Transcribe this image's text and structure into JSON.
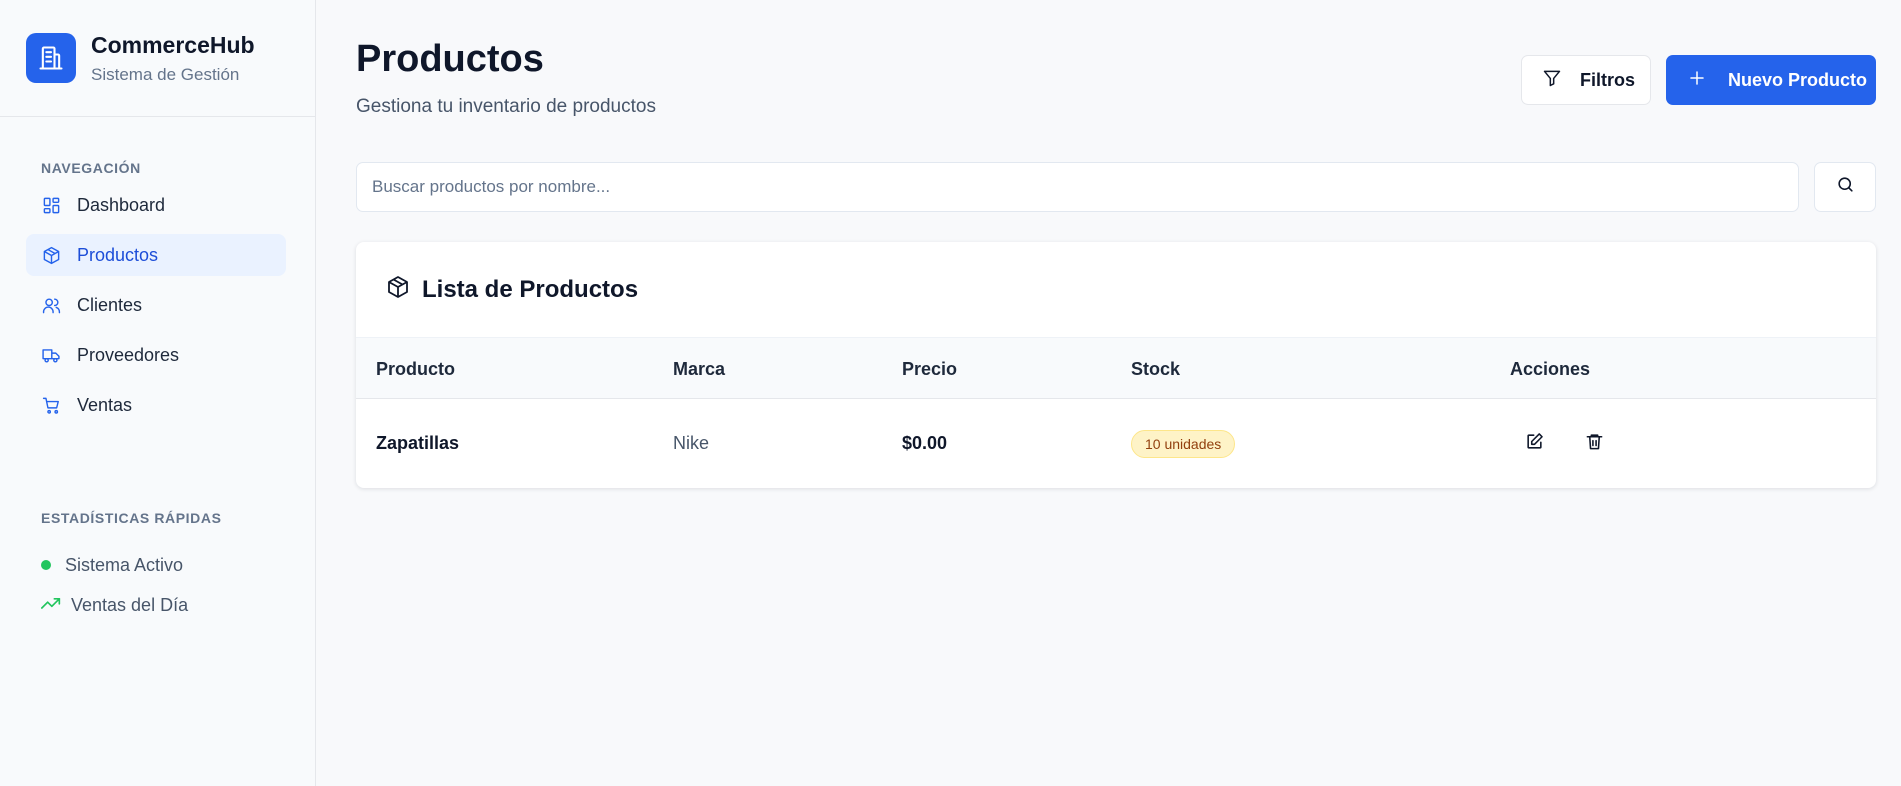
{
  "brand": {
    "name": "CommerceHub",
    "subtitle": "Sistema de Gestión"
  },
  "sidebar": {
    "nav_label": "NAVEGACIÓN",
    "items": [
      {
        "label": "Dashboard",
        "icon": "layout-grid-icon",
        "active": false
      },
      {
        "label": "Productos",
        "icon": "package-icon",
        "active": true
      },
      {
        "label": "Clientes",
        "icon": "users-icon",
        "active": false
      },
      {
        "label": "Proveedores",
        "icon": "truck-icon",
        "active": false
      },
      {
        "label": "Ventas",
        "icon": "shopping-cart-icon",
        "active": false
      }
    ],
    "stats_label": "ESTADÍSTICAS RÁPIDAS",
    "stats": [
      {
        "label": "Sistema Activo",
        "icon": "status-dot"
      },
      {
        "label": "Ventas del Día",
        "icon": "trending-up-icon"
      }
    ]
  },
  "header": {
    "title": "Productos",
    "subtitle": "Gestiona tu inventario de productos",
    "filter_label": "Filtros",
    "new_label": "Nuevo Producto"
  },
  "search": {
    "placeholder": "Buscar productos por nombre...",
    "value": ""
  },
  "table": {
    "title": "Lista de Productos",
    "columns": [
      "Producto",
      "Marca",
      "Precio",
      "Stock",
      "Acciones"
    ],
    "rows": [
      {
        "producto": "Zapatillas",
        "marca": "Nike",
        "precio": "$0.00",
        "stock": "10 unidades"
      }
    ]
  },
  "colors": {
    "accent": "#2563eb",
    "active_bg": "#eaf2ff",
    "success": "#22c55e",
    "badge_bg": "#fef3c7"
  }
}
